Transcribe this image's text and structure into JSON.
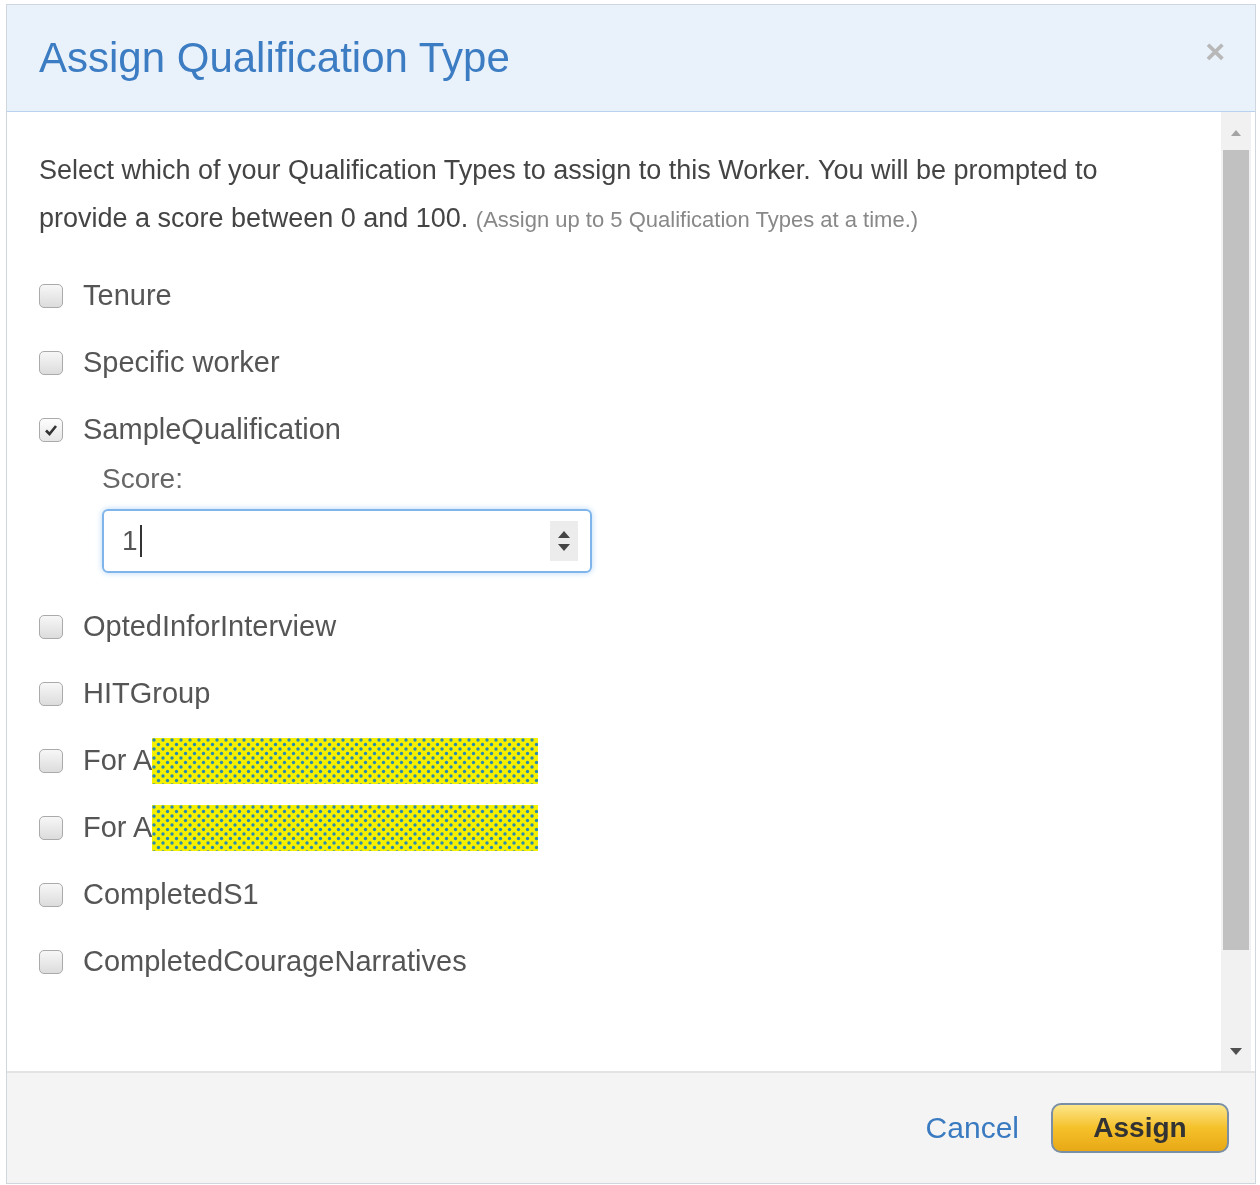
{
  "dialog": {
    "title": "Assign Qualification Type",
    "close": "×"
  },
  "intro": {
    "text": "Select which of your Qualification Types to assign to this Worker. You will be prompted to provide a score between 0 and 100.",
    "note": "(Assign up to 5 Qualification Types at a time.)"
  },
  "qualifications": [
    {
      "label": "Tenure",
      "checked": false,
      "redacted": false
    },
    {
      "label": "Specific worker",
      "checked": false,
      "redacted": false
    },
    {
      "label": "SampleQualification",
      "checked": true,
      "redacted": false,
      "score": {
        "label": "Score:",
        "value": "1"
      }
    },
    {
      "label": "OptedInforInterview",
      "checked": false,
      "redacted": false
    },
    {
      "label": "HITGroup",
      "checked": false,
      "redacted": false
    },
    {
      "label": "For A",
      "checked": false,
      "redacted": true
    },
    {
      "label": "For A",
      "checked": false,
      "redacted": true
    },
    {
      "label": "CompletedS1",
      "checked": false,
      "redacted": false
    },
    {
      "label": "CompletedCourageNarratives",
      "checked": false,
      "redacted": false
    }
  ],
  "buttons": [
    {
      "label": "Cancel",
      "kind": "link"
    },
    {
      "label": "Assign",
      "kind": "primary"
    }
  ]
}
